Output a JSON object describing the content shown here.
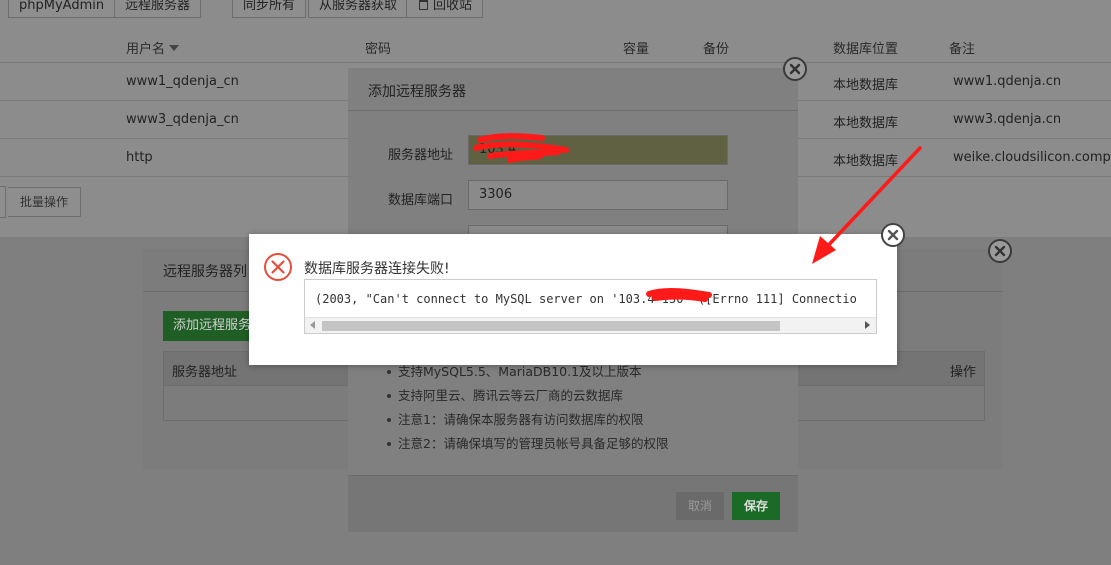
{
  "toolbar": {
    "buttons": [
      "phpMyAdmin",
      "远程服务器",
      "同步所有",
      "从服务器获取",
      "回收站"
    ]
  },
  "table": {
    "headers": {
      "username": "用户名",
      "password": "密码",
      "capacity": "容量",
      "backup": "备份",
      "location": "数据库位置",
      "note": "备注"
    },
    "rows": [
      {
        "username": "www1_qdenja_cn",
        "location": "本地数据库",
        "note": "www1.qdenja.cn"
      },
      {
        "username": "www3_qdenja_cn",
        "location": "本地数据库",
        "note": "www3.qdenja.cn"
      },
      {
        "username": "http",
        "location": "本地数据库",
        "note": "weike.cloudsilicon.company"
      }
    ],
    "batch_label": "批量操作"
  },
  "remote_list": {
    "title": "远程服务器列",
    "add_button": "添加远程服务",
    "col_address": "服务器地址",
    "col_action": "操作"
  },
  "add_dialog": {
    "title": "添加远程服务器",
    "host_label": "服务器地址",
    "host_value": "103.4",
    "port_label": "数据库端口",
    "port_value": "3306",
    "tips": [
      "支持MySQL5.5、MariaDB10.1及以上版本",
      "支持阿里云、腾讯云等云厂商的云数据库",
      "注意1：请确保本服务器有访问数据库的权限",
      "注意2：请确保填写的管理员帐号具备足够的权限"
    ],
    "cancel_label": "取消",
    "save_label": "保存"
  },
  "error": {
    "title": "数据库服务器连接失败!",
    "message": "(2003, \"Can't connect to MySQL server on '103.4      150' ([Errno 111] Connectio"
  },
  "colors": {
    "accent_green": "#20a53a",
    "error_red": "#e64e3c",
    "annotation_red": "#ff1a1a"
  }
}
